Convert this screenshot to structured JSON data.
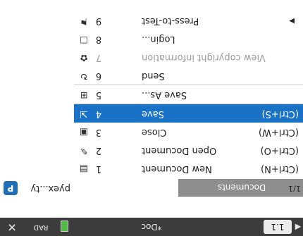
{
  "topbar": {
    "tab_label": "1.1",
    "document_title": "*Doc",
    "mode_label": "RAD",
    "left_arrow": "◀",
    "right_arrow": "▶",
    "close": "✕"
  },
  "header": {
    "file_name": "pyex...ty",
    "page_counter": "1/1",
    "submenu_title": "Documents"
  },
  "menu": {
    "items": [
      {
        "num": "1",
        "label": "New Document",
        "shortcut": "(Ctrl+N)",
        "icon": "new-document-icon"
      },
      {
        "num": "2",
        "label": "Open Document",
        "shortcut": "(Ctrl+O)",
        "icon": "open-document-icon"
      },
      {
        "num": "3",
        "label": "Close",
        "shortcut": "(Ctrl+W)",
        "icon": "close-document-icon"
      },
      {
        "num": "4",
        "label": "Save",
        "shortcut": "(Ctrl+S)",
        "icon": "save-icon"
      },
      {
        "num": "5",
        "label": "Save As...",
        "shortcut": "",
        "icon": "save-as-icon"
      },
      {
        "num": "6",
        "label": "Send",
        "shortcut": "",
        "icon": "send-icon"
      },
      {
        "num": "7",
        "label": "View copyright information",
        "shortcut": "",
        "icon": "settings-icon"
      },
      {
        "num": "8",
        "label": "Login...",
        "shortcut": "",
        "icon": "login-icon"
      },
      {
        "num": "9",
        "label": "Press-to-Test",
        "shortcut": "",
        "icon": "press-to-test-icon"
      }
    ],
    "submenu_left_nums": [
      "1",
      "2",
      "3",
      "4",
      "5",
      "6",
      "7",
      "8",
      "9"
    ],
    "submenu_arrow": "▶"
  },
  "colors": {
    "selection": "#1a72c7",
    "topbar": "#3c3c3c",
    "header": "#8e8e8e"
  }
}
